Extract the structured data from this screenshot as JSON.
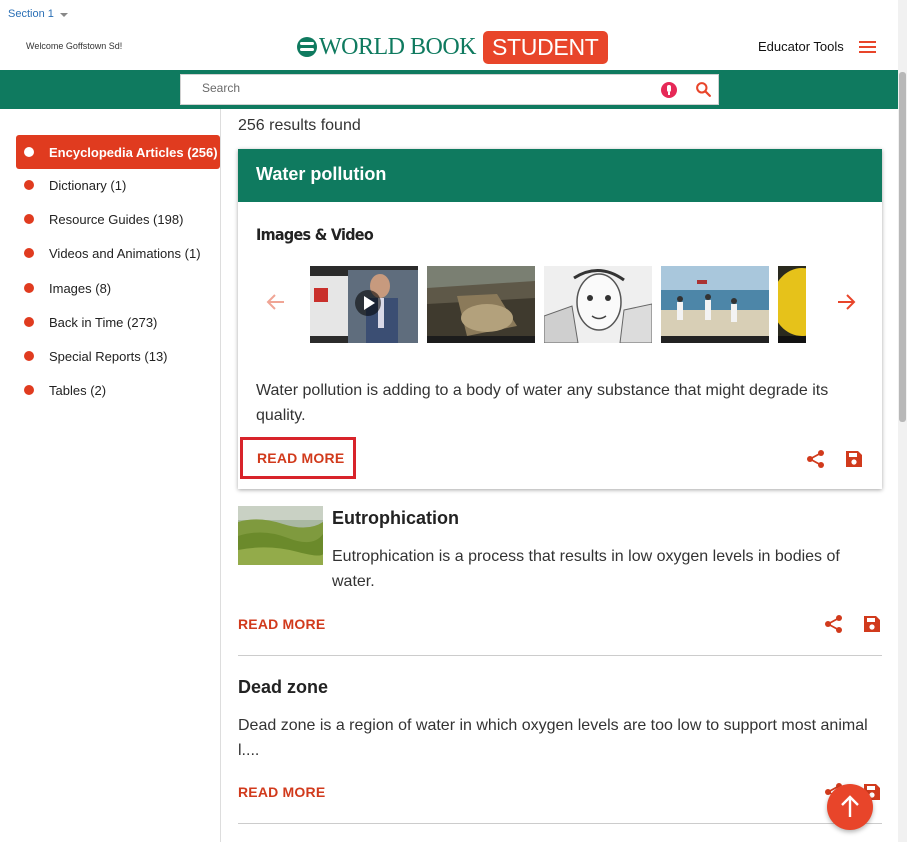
{
  "header": {
    "section_label": "Section 1",
    "welcome": "Welcome Goffstown Sd!",
    "logo_main": "WORLD BOOK",
    "logo_badge": "STUDENT",
    "educator_tools": "Educator Tools"
  },
  "search": {
    "placeholder": "Search",
    "value": ""
  },
  "sidebar": {
    "facets": [
      {
        "label": "Encyclopedia Articles (256)",
        "active": true
      },
      {
        "label": "Dictionary (1)"
      },
      {
        "label": "Resource Guides (198)"
      },
      {
        "label": "Videos and Animations (1)"
      },
      {
        "label": "Images (8)"
      },
      {
        "label": "Back in Time (273)"
      },
      {
        "label": "Special Reports (13)"
      },
      {
        "label": "Tables (2)"
      }
    ]
  },
  "results": {
    "count_text": "256 results found",
    "featured": {
      "title": "Water pollution",
      "media_heading": "Images & Video",
      "description": "Water pollution is adding to a body of water any substance that might degrade its quality.",
      "read_more": "READ MORE"
    },
    "items": [
      {
        "title": "Eutrophication",
        "description": "Eutrophication is a process that results in low oxygen levels in bodies of water.",
        "read_more": "READ MORE"
      },
      {
        "title": "Dead zone",
        "description": "Dead zone is a region of water in which oxygen levels are too low to support most animal l....",
        "read_more": "READ MORE"
      }
    ]
  },
  "colors": {
    "brand_green": "#0f7a5f",
    "accent_red": "#e8452a",
    "highlight_border": "#d8232a"
  }
}
